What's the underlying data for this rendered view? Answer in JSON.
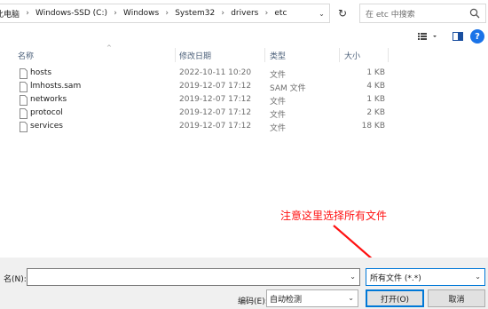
{
  "breadcrumb": [
    "此电脑",
    "Windows-SSD (C:)",
    "Windows",
    "System32",
    "drivers",
    "etc"
  ],
  "search": {
    "placeholder": "在 etc 中搜索"
  },
  "columns": {
    "name": "名称",
    "date": "修改日期",
    "type": "类型",
    "size": "大小"
  },
  "files": [
    {
      "name": "hosts",
      "date": "2022-10-11 10:20",
      "type": "文件",
      "size": "1 KB"
    },
    {
      "name": "lmhosts.sam",
      "date": "2019-12-07 17:12",
      "type": "SAM 文件",
      "size": "4 KB"
    },
    {
      "name": "networks",
      "date": "2019-12-07 17:12",
      "type": "文件",
      "size": "1 KB"
    },
    {
      "name": "protocol",
      "date": "2019-12-07 17:12",
      "type": "文件",
      "size": "2 KB"
    },
    {
      "name": "services",
      "date": "2019-12-07 17:12",
      "type": "文件",
      "size": "18 KB"
    }
  ],
  "annotation": "注意这里选择所有文件",
  "filename": {
    "label": "名(N):",
    "value": ""
  },
  "filetype": {
    "selected": "所有文件  (*.*)"
  },
  "encoding": {
    "label": "编码(E):",
    "selected": "自动检测"
  },
  "buttons": {
    "open": "打开(O)",
    "cancel": "取消"
  },
  "colors": {
    "annotation": "#ff1010",
    "accent": "#0078d7",
    "help": "#1a73e8"
  },
  "icons": [
    "chevron-right-icon",
    "chevron-down-icon",
    "refresh-icon",
    "search-icon",
    "view-options-icon",
    "preview-pane-icon",
    "help-icon",
    "file-icon"
  ]
}
